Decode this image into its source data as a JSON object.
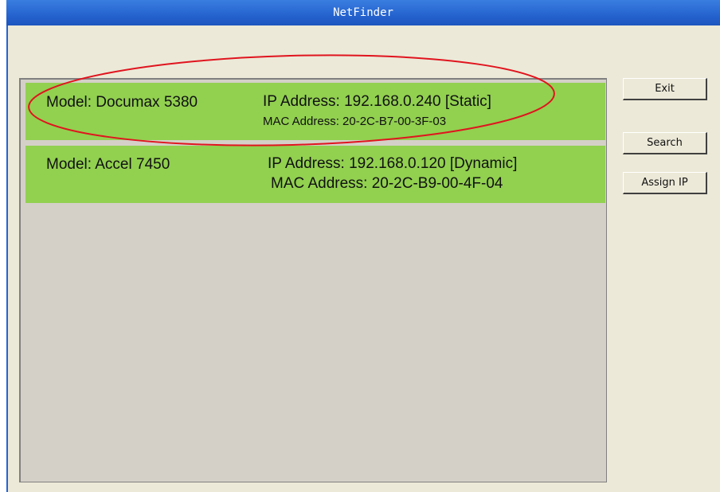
{
  "window": {
    "title": "NetFinder"
  },
  "devices": [
    {
      "model": "Model: Documax 5380",
      "ip": "IP Address: 192.168.0.240 [Static]",
      "mac": "MAC Address: 20-2C-B7-00-3F-03"
    },
    {
      "model": "Model: Accel 7450",
      "ip": "IP Address: 192.168.0.120 [Dynamic]",
      "mac": "MAC Address: 20-2C-B9-00-4F-04"
    }
  ],
  "buttons": {
    "exit": "Exit",
    "search": "Search",
    "assign_ip": "Assign IP"
  },
  "colors": {
    "row_bg": "#92d050",
    "annotation": "#e0141e",
    "titlebar": "#2563cf"
  }
}
